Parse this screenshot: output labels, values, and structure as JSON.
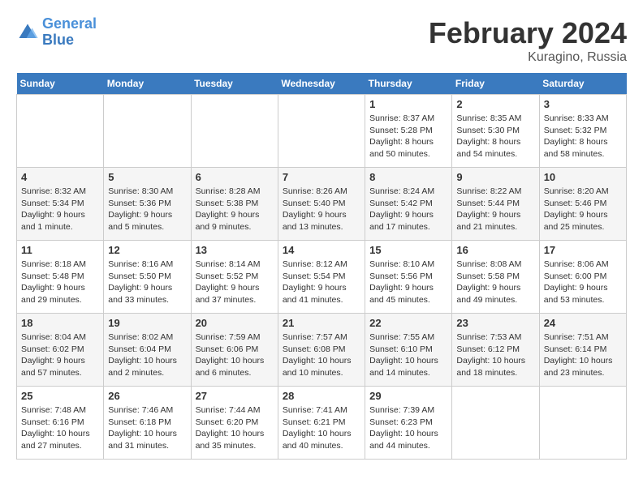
{
  "header": {
    "logo_line1": "General",
    "logo_line2": "Blue",
    "month_title": "February 2024",
    "subtitle": "Kuragino, Russia"
  },
  "days_of_week": [
    "Sunday",
    "Monday",
    "Tuesday",
    "Wednesday",
    "Thursday",
    "Friday",
    "Saturday"
  ],
  "weeks": [
    [
      {
        "day": "",
        "sunrise": "",
        "sunset": "",
        "daylight": ""
      },
      {
        "day": "",
        "sunrise": "",
        "sunset": "",
        "daylight": ""
      },
      {
        "day": "",
        "sunrise": "",
        "sunset": "",
        "daylight": ""
      },
      {
        "day": "",
        "sunrise": "",
        "sunset": "",
        "daylight": ""
      },
      {
        "day": "1",
        "sunrise": "Sunrise: 8:37 AM",
        "sunset": "Sunset: 5:28 PM",
        "daylight": "Daylight: 8 hours and 50 minutes."
      },
      {
        "day": "2",
        "sunrise": "Sunrise: 8:35 AM",
        "sunset": "Sunset: 5:30 PM",
        "daylight": "Daylight: 8 hours and 54 minutes."
      },
      {
        "day": "3",
        "sunrise": "Sunrise: 8:33 AM",
        "sunset": "Sunset: 5:32 PM",
        "daylight": "Daylight: 8 hours and 58 minutes."
      }
    ],
    [
      {
        "day": "4",
        "sunrise": "Sunrise: 8:32 AM",
        "sunset": "Sunset: 5:34 PM",
        "daylight": "Daylight: 9 hours and 1 minute."
      },
      {
        "day": "5",
        "sunrise": "Sunrise: 8:30 AM",
        "sunset": "Sunset: 5:36 PM",
        "daylight": "Daylight: 9 hours and 5 minutes."
      },
      {
        "day": "6",
        "sunrise": "Sunrise: 8:28 AM",
        "sunset": "Sunset: 5:38 PM",
        "daylight": "Daylight: 9 hours and 9 minutes."
      },
      {
        "day": "7",
        "sunrise": "Sunrise: 8:26 AM",
        "sunset": "Sunset: 5:40 PM",
        "daylight": "Daylight: 9 hours and 13 minutes."
      },
      {
        "day": "8",
        "sunrise": "Sunrise: 8:24 AM",
        "sunset": "Sunset: 5:42 PM",
        "daylight": "Daylight: 9 hours and 17 minutes."
      },
      {
        "day": "9",
        "sunrise": "Sunrise: 8:22 AM",
        "sunset": "Sunset: 5:44 PM",
        "daylight": "Daylight: 9 hours and 21 minutes."
      },
      {
        "day": "10",
        "sunrise": "Sunrise: 8:20 AM",
        "sunset": "Sunset: 5:46 PM",
        "daylight": "Daylight: 9 hours and 25 minutes."
      }
    ],
    [
      {
        "day": "11",
        "sunrise": "Sunrise: 8:18 AM",
        "sunset": "Sunset: 5:48 PM",
        "daylight": "Daylight: 9 hours and 29 minutes."
      },
      {
        "day": "12",
        "sunrise": "Sunrise: 8:16 AM",
        "sunset": "Sunset: 5:50 PM",
        "daylight": "Daylight: 9 hours and 33 minutes."
      },
      {
        "day": "13",
        "sunrise": "Sunrise: 8:14 AM",
        "sunset": "Sunset: 5:52 PM",
        "daylight": "Daylight: 9 hours and 37 minutes."
      },
      {
        "day": "14",
        "sunrise": "Sunrise: 8:12 AM",
        "sunset": "Sunset: 5:54 PM",
        "daylight": "Daylight: 9 hours and 41 minutes."
      },
      {
        "day": "15",
        "sunrise": "Sunrise: 8:10 AM",
        "sunset": "Sunset: 5:56 PM",
        "daylight": "Daylight: 9 hours and 45 minutes."
      },
      {
        "day": "16",
        "sunrise": "Sunrise: 8:08 AM",
        "sunset": "Sunset: 5:58 PM",
        "daylight": "Daylight: 9 hours and 49 minutes."
      },
      {
        "day": "17",
        "sunrise": "Sunrise: 8:06 AM",
        "sunset": "Sunset: 6:00 PM",
        "daylight": "Daylight: 9 hours and 53 minutes."
      }
    ],
    [
      {
        "day": "18",
        "sunrise": "Sunrise: 8:04 AM",
        "sunset": "Sunset: 6:02 PM",
        "daylight": "Daylight: 9 hours and 57 minutes."
      },
      {
        "day": "19",
        "sunrise": "Sunrise: 8:02 AM",
        "sunset": "Sunset: 6:04 PM",
        "daylight": "Daylight: 10 hours and 2 minutes."
      },
      {
        "day": "20",
        "sunrise": "Sunrise: 7:59 AM",
        "sunset": "Sunset: 6:06 PM",
        "daylight": "Daylight: 10 hours and 6 minutes."
      },
      {
        "day": "21",
        "sunrise": "Sunrise: 7:57 AM",
        "sunset": "Sunset: 6:08 PM",
        "daylight": "Daylight: 10 hours and 10 minutes."
      },
      {
        "day": "22",
        "sunrise": "Sunrise: 7:55 AM",
        "sunset": "Sunset: 6:10 PM",
        "daylight": "Daylight: 10 hours and 14 minutes."
      },
      {
        "day": "23",
        "sunrise": "Sunrise: 7:53 AM",
        "sunset": "Sunset: 6:12 PM",
        "daylight": "Daylight: 10 hours and 18 minutes."
      },
      {
        "day": "24",
        "sunrise": "Sunrise: 7:51 AM",
        "sunset": "Sunset: 6:14 PM",
        "daylight": "Daylight: 10 hours and 23 minutes."
      }
    ],
    [
      {
        "day": "25",
        "sunrise": "Sunrise: 7:48 AM",
        "sunset": "Sunset: 6:16 PM",
        "daylight": "Daylight: 10 hours and 27 minutes."
      },
      {
        "day": "26",
        "sunrise": "Sunrise: 7:46 AM",
        "sunset": "Sunset: 6:18 PM",
        "daylight": "Daylight: 10 hours and 31 minutes."
      },
      {
        "day": "27",
        "sunrise": "Sunrise: 7:44 AM",
        "sunset": "Sunset: 6:20 PM",
        "daylight": "Daylight: 10 hours and 35 minutes."
      },
      {
        "day": "28",
        "sunrise": "Sunrise: 7:41 AM",
        "sunset": "Sunset: 6:21 PM",
        "daylight": "Daylight: 10 hours and 40 minutes."
      },
      {
        "day": "29",
        "sunrise": "Sunrise: 7:39 AM",
        "sunset": "Sunset: 6:23 PM",
        "daylight": "Daylight: 10 hours and 44 minutes."
      },
      {
        "day": "",
        "sunrise": "",
        "sunset": "",
        "daylight": ""
      },
      {
        "day": "",
        "sunrise": "",
        "sunset": "",
        "daylight": ""
      }
    ]
  ]
}
